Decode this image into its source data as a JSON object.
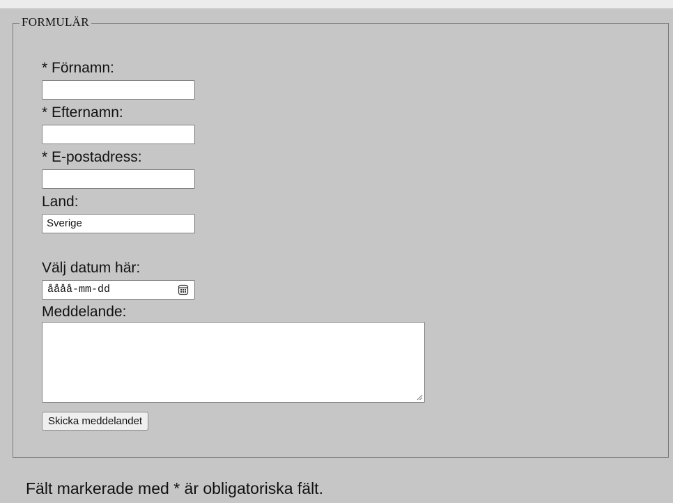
{
  "form": {
    "legend": "FORMULÄR",
    "fields": {
      "first_name": {
        "label": "* Förnamn:",
        "value": ""
      },
      "last_name": {
        "label": "* Efternamn:",
        "value": ""
      },
      "email": {
        "label": "* E-postadress:",
        "value": ""
      },
      "country": {
        "label": "Land:",
        "value": "Sverige"
      },
      "date": {
        "label": "Välj datum här:",
        "placeholder": "åååå-mm-dd",
        "icon": "calendar-icon"
      },
      "message": {
        "label": "Meddelande:",
        "value": ""
      }
    },
    "submit_label": "Skicka meddelandet"
  },
  "footnote": "Fält markerade med * är obligatoriska fält.",
  "colors": {
    "page_background": "#c6c6c6",
    "field_background": "#ffffff",
    "button_background": "#efefef"
  }
}
